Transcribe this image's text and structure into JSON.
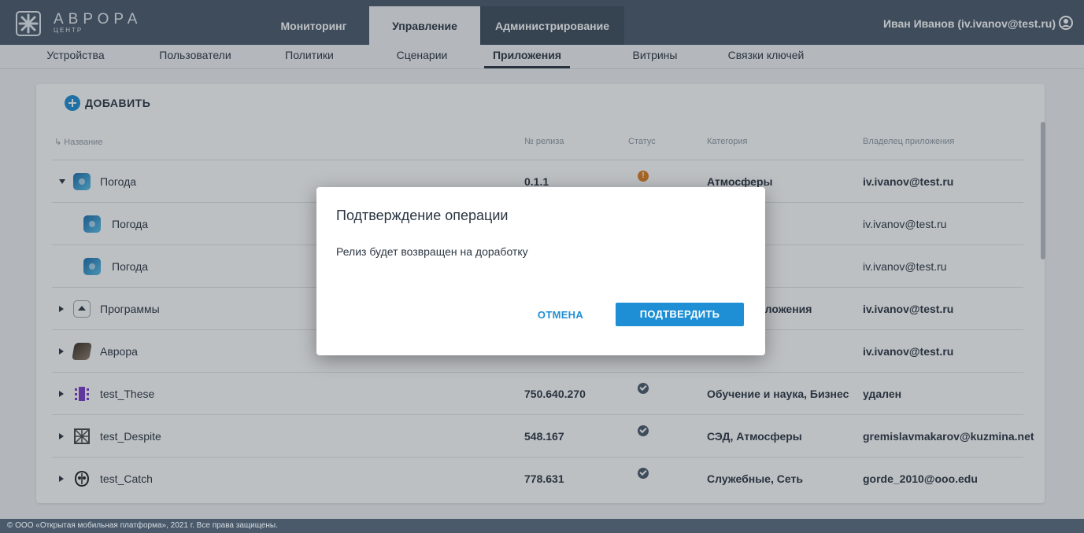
{
  "header": {
    "logo_text": "АВРОРА",
    "logo_sub": "ЦЕНТР",
    "tabs": [
      "Мониторинг",
      "Управление",
      "Администрирование"
    ],
    "active_tab": "Управление",
    "user": "Иван Иванов (iv.ivanov@test.ru)",
    "brand_color": "#4a5a6b"
  },
  "subnav": {
    "items": [
      "Устройства",
      "Пользователи",
      "Политики",
      "Сценарии",
      "Приложения",
      "Витрины",
      "Связки ключей"
    ],
    "active": "Приложения"
  },
  "toolbar": {
    "add_label": "ДОБАВИТЬ"
  },
  "table": {
    "headers": [
      "Название",
      "№ релиза",
      "Статус",
      "Категория",
      "Владелец приложения"
    ],
    "rows": [
      {
        "name": "Погода",
        "release": "0.1.1",
        "category": "Атмосферы",
        "owner": "iv.ivanov@test.ru"
      },
      {
        "name": "Погода",
        "release": "",
        "category": "",
        "owner": "iv.ivanov@test.ru"
      },
      {
        "name": "Погода",
        "release": "",
        "category": "",
        "owner": "iv.ivanov@test.ru"
      },
      {
        "name": "Программы",
        "release": "",
        "category": "приложения",
        "owner": "iv.ivanov@test.ru"
      },
      {
        "name": "Аврора",
        "release": "",
        "category": "",
        "owner": "iv.ivanov@test.ru"
      },
      {
        "name": "test_These",
        "release": "750.640.270",
        "category": "Обучение и наука, Бизнес",
        "owner": "удален"
      },
      {
        "name": "test_Despite",
        "release": "548.167",
        "category": "СЭД, Атмосферы",
        "owner": "gremislavmakarov@kuzmina.net"
      },
      {
        "name": "test_Catch",
        "release": "778.631",
        "category": "Служебные, Сеть",
        "owner": "gorde_2010@ooo.edu"
      }
    ]
  },
  "dialog": {
    "title": "Подтверждение операции",
    "message": "Релиз будет возвращен на доработку",
    "cancel": "ОТМЕНА",
    "confirm": "ПОДТВЕРДИТЬ",
    "accent_color": "#1e8fd5"
  },
  "footer": {
    "text": "© ООО «Открытая мобильная платформа», 2021 г. Все права защищены."
  }
}
